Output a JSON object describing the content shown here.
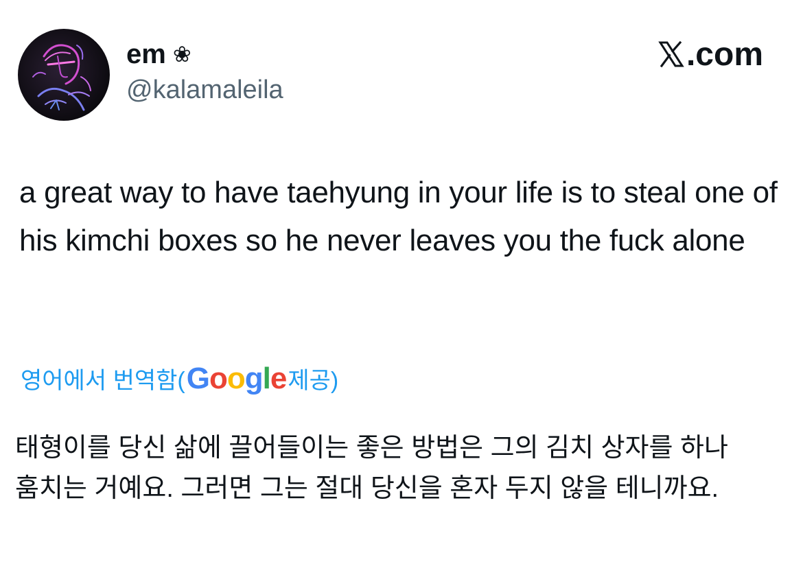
{
  "author": {
    "display_name": "em",
    "handle": "@kalamaleila",
    "name_icon": "flower-icon",
    "avatar_icon": "neon-figure-avatar"
  },
  "brand": {
    "label": ".com",
    "icon": "x-logo-icon"
  },
  "tweet": {
    "text": "a great way to have taehyung in your life is to steal one of his kimchi boxes so he never leaves you the fuck alone"
  },
  "translation": {
    "label_prefix": "영어에서 번역함(",
    "provider": "Google",
    "label_suffix": " 제공)",
    "text": "태형이를 당신 삶에 끌어들이는 좋은 방법은 그의 김치 상자를 하나 훔치는 거예요. 그러면 그는 절대 당신을 혼자 두지 않을 테니까요.",
    "colors": {
      "link": "#1d9bf0",
      "google_blue": "#4285f4",
      "google_red": "#ea4335",
      "google_yellow": "#fbbc05",
      "google_green": "#34a853"
    }
  }
}
